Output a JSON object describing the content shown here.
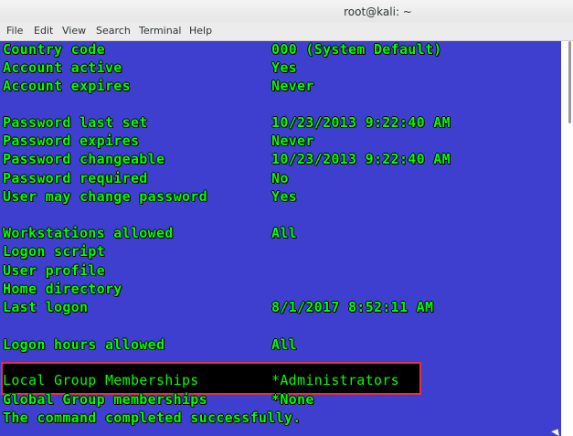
{
  "window": {
    "title": "root@kali: ~"
  },
  "menubar": {
    "items": [
      "File",
      "Edit",
      "View",
      "Search",
      "Terminal",
      "Help"
    ]
  },
  "terminal": {
    "background": "#3f3fcf",
    "text_color": "#00ff00",
    "lines": [
      {
        "key": "Country code",
        "value": "000 (System Default)"
      },
      {
        "key": "Account active",
        "value": "Yes"
      },
      {
        "key": "Account expires",
        "value": "Never"
      },
      {
        "key": "",
        "value": ""
      },
      {
        "key": "Password last set",
        "value": "10/23/2013 9:22:40 AM"
      },
      {
        "key": "Password expires",
        "value": "Never"
      },
      {
        "key": "Password changeable",
        "value": "10/23/2013 9:22:40 AM"
      },
      {
        "key": "Password required",
        "value": "No"
      },
      {
        "key": "User may change password",
        "value": "Yes"
      },
      {
        "key": "",
        "value": ""
      },
      {
        "key": "Workstations allowed",
        "value": "All"
      },
      {
        "key": "Logon script",
        "value": ""
      },
      {
        "key": "User profile",
        "value": ""
      },
      {
        "key": "Home directory",
        "value": ""
      },
      {
        "key": "Last logon",
        "value": "8/1/2017 8:52:11 AM"
      },
      {
        "key": "",
        "value": ""
      },
      {
        "key": "Logon hours allowed",
        "value": "All"
      },
      {
        "key": "",
        "value": ""
      },
      {
        "key": "Local Group Memberships",
        "value": "*Administrators"
      },
      {
        "key": "Global Group memberships",
        "value": "*None"
      },
      {
        "key": "The command completed successfully.",
        "value": ""
      }
    ],
    "highlight_color": "#e0304a"
  }
}
